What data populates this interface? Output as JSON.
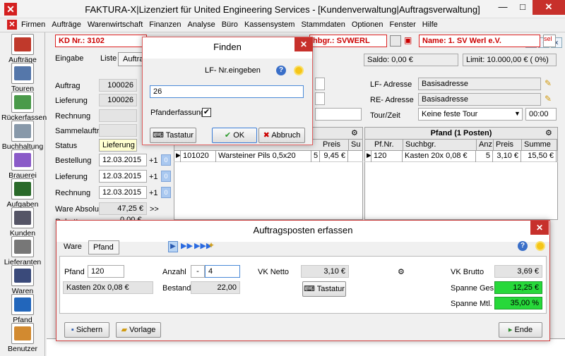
{
  "window": {
    "title": "FAKTURA-X|Lizenziert für United Engineering Services - [Kundenverwaltung|Auftragsverwaltung]",
    "app_icon_glyph": "✕",
    "min_glyph": "—",
    "max_glyph": "□",
    "close_glyph": "✕"
  },
  "menu": {
    "items": [
      "Firmen",
      "Aufträge",
      "Warenwirtschaft",
      "Finanzen",
      "Analyse",
      "Büro",
      "Kassensystem",
      "Stammdaten",
      "Optionen",
      "Fenster",
      "Hilfe"
    ],
    "mdi_min": "_",
    "mdi_restore": "▫",
    "mdi_close": "x"
  },
  "sidebar": {
    "items": [
      {
        "label": "Aufträge",
        "icon": "orders-icon",
        "color": "#c0392b"
      },
      {
        "label": "Touren",
        "icon": "truck-icon",
        "color": "#5577aa"
      },
      {
        "label": "Rückerfassen",
        "icon": "return-truck-icon",
        "color": "#4a9a4a"
      },
      {
        "label": "Buchhaltung",
        "icon": "accounting-icon",
        "color": "#8899aa"
      },
      {
        "label": "Brauerei",
        "icon": "brewery-icon",
        "color": "#8a5ac8"
      },
      {
        "label": "Aufgaben",
        "icon": "tasks-icon",
        "color": "#2a6a2a"
      },
      {
        "label": "Kunden",
        "icon": "customers-icon",
        "color": "#555566"
      },
      {
        "label": "Lieferanten",
        "icon": "suppliers-icon",
        "color": "#777777"
      },
      {
        "label": "Waren",
        "icon": "goods-icon",
        "color": "#3a4a7a"
      },
      {
        "label": "Pfand",
        "icon": "deposit-icon",
        "color": "#2266bb"
      },
      {
        "label": "Benutzer",
        "icon": "user-icon",
        "color": "#d28a30"
      }
    ]
  },
  "header": {
    "kd_nr": "KD Nr.: 3102",
    "suchbegriff": "hbgr.: SVWERL",
    "name": "Name: 1. SV Werl e.V."
  },
  "tabs": {
    "eingabe": "Eingabe",
    "liste": "Liste",
    "auftrag": "Auftrag"
  },
  "order": {
    "auftrag_label": "Auftrag",
    "auftrag_value": "100026",
    "lieferung_label": "Lieferung",
    "lieferung_value": "100026",
    "rechnung_label": "Rechnung",
    "sammelauftrag_label": "Sammelauftrag",
    "status_label": "Status",
    "status_value": "Lieferung",
    "bestellung_label": "Bestellung",
    "bestellung_date": "12.03.2015",
    "lieferung2_label": "Lieferung",
    "lieferung_date": "12.03.2015",
    "rechnung2_label": "Rechnung",
    "rechnung_date": "12.03.2015",
    "plus1": "+1",
    "zero": "0",
    "ware_absolut_label": "Ware Absolut",
    "ware_absolut_value": "47,25 €",
    "ware_arrows": ">>",
    "rabatt_label": "Rabatt",
    "rabatt_value": "0,00 €"
  },
  "right_panel": {
    "saldo": "Saldo: 0,00 €",
    "limit": "Limit: 10.000,00 € ( 0%)",
    "lf_adresse_label": "LF- Adresse",
    "lf_adresse_value": "Basisadresse",
    "re_adresse_label": "RE- Adresse",
    "re_adresse_value": "Basisadresse",
    "tour_label": "Tour/Zeit",
    "tour_value": "Keine feste Tour",
    "time_value": "00:00"
  },
  "items_grid": {
    "headers": [
      "Preis",
      "Su"
    ],
    "row": {
      "nr": "101020",
      "name": "Warsteiner Pils 0,5x20",
      "qty": "5",
      "price": "9,45 €"
    }
  },
  "pfand_grid": {
    "title": "Pfand (1 Posten)",
    "headers": [
      "Pf.Nr.",
      "Suchbgr.",
      "Anz.",
      "Preis",
      "Summe"
    ],
    "row": {
      "nr": "120",
      "name": "Kasten 20x 0,08 €",
      "qty": "5",
      "price": "3,10 €",
      "sum": "15,50 €"
    }
  },
  "finden": {
    "title": "Finden",
    "prompt": "LF- Nr.eingeben",
    "input_value": "26",
    "pfand_label": "Pfanderfassung",
    "pfand_checked": "✔",
    "tastatur": "Tastatur",
    "ok": "OK",
    "abbruch": "Abbruch",
    "close": "✕"
  },
  "posten": {
    "title": "Auftragsposten erfassen",
    "close": "✕",
    "tab_ware": "Ware",
    "tab_pfand": "Pfand",
    "pfand_label": "Pfand",
    "pfand_value": "120",
    "pfand_desc": "Kasten 20x 0,08 €",
    "anzahl_label": "Anzahl",
    "anzahl_minus": "-",
    "anzahl_value": "4",
    "bestand_label": "Bestand",
    "bestand_value": "22,00",
    "vk_netto_label": "VK Netto",
    "vk_netto_value": "3,10 €",
    "tastatur": "Tastatur",
    "vk_brutto_label": "VK Brutto",
    "vk_brutto_value": "3,69 €",
    "spanne_ges_label": "Spanne Ges.",
    "spanne_ges_value": "12,25 €",
    "spanne_mtl_label": "Spanne Mtl.",
    "spanne_mtl_value": "35,00 %",
    "sichern": "Sichern",
    "vorlage": "Vorlage",
    "ende": "Ende"
  },
  "colors": {
    "accent_red": "#c7302b",
    "green_field": "#27d83a",
    "nav_blue": "#3a7bd5"
  }
}
